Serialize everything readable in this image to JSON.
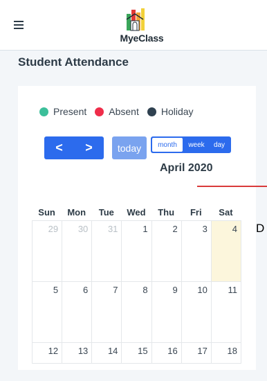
{
  "header": {
    "logo_text": "MyeClass"
  },
  "page": {
    "title": "Student Attendance"
  },
  "legend": [
    {
      "label": "Present",
      "color": "#3cbf9a"
    },
    {
      "label": "Absent",
      "color": "#ef2d4a"
    },
    {
      "label": "Holiday",
      "color": "#2f4150"
    }
  ],
  "toolbar": {
    "prev_label": "<",
    "next_label": ">",
    "today_label": "today",
    "views": [
      "month",
      "week",
      "day"
    ],
    "active_view": "month"
  },
  "calendar": {
    "title": "April 2020",
    "weekdays": [
      "Sun",
      "Mon",
      "Tue",
      "Wed",
      "Thu",
      "Fri",
      "Sat"
    ],
    "weeks": [
      [
        {
          "d": "29",
          "other": true
        },
        {
          "d": "30",
          "other": true
        },
        {
          "d": "31",
          "other": true
        },
        {
          "d": "1"
        },
        {
          "d": "2"
        },
        {
          "d": "3"
        },
        {
          "d": "4",
          "highlight": true
        }
      ],
      [
        {
          "d": "5"
        },
        {
          "d": "6"
        },
        {
          "d": "7"
        },
        {
          "d": "8"
        },
        {
          "d": "9"
        },
        {
          "d": "10"
        },
        {
          "d": "11"
        }
      ],
      [
        {
          "d": "12"
        },
        {
          "d": "13"
        },
        {
          "d": "14"
        },
        {
          "d": "15"
        },
        {
          "d": "16"
        },
        {
          "d": "17"
        },
        {
          "d": "18"
        }
      ]
    ]
  },
  "annotation": {
    "letter": "D"
  },
  "colors": {
    "accent": "#2c6bed",
    "today_btn": "#7aa3ef",
    "highlight_day": "#fcf6dc"
  }
}
